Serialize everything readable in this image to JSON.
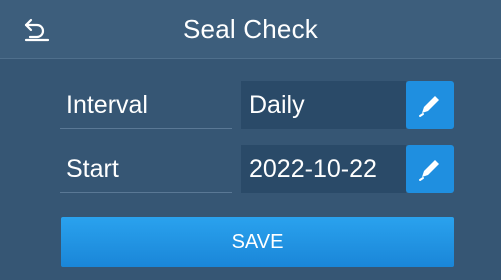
{
  "header": {
    "title": "Seal Check",
    "back_icon": "back-arrow-icon"
  },
  "settings": [
    {
      "label": "Interval",
      "value": "Daily",
      "edit_icon": "pencil-icon"
    },
    {
      "label": "Start",
      "value": "2022-10-22",
      "edit_icon": "pencil-icon"
    }
  ],
  "save_label": "SAVE",
  "colors": {
    "background": "#3a5a78",
    "value_field": "#2a4a68",
    "accent": "#1f8fe0"
  }
}
